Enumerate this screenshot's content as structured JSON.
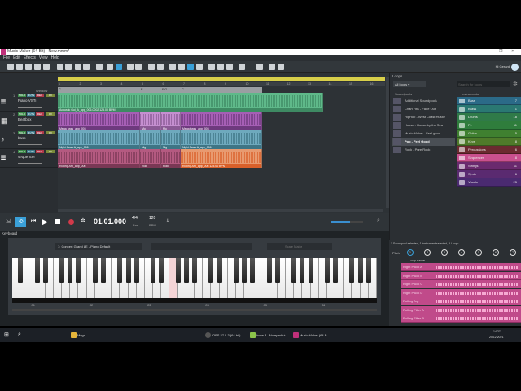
{
  "window": {
    "title": "Music Maker (64-Bit) - New.mmm*",
    "minimize": "–",
    "maximize": "❐",
    "close": "✕"
  },
  "menu": [
    "File",
    "Edit",
    "Effects",
    "View",
    "Help"
  ],
  "toolbar": {
    "user": "Hi Gerard"
  },
  "arranger": {
    "window_label": "Window",
    "chords": [
      "C",
      "F",
      "F,G",
      "C"
    ],
    "ruler": [
      "1",
      "2",
      "3",
      "4",
      "5",
      "6",
      "7",
      "8",
      "9",
      "10",
      "11",
      "12",
      "13",
      "14",
      "15",
      "16",
      "17"
    ]
  },
  "tracks": [
    {
      "num": "1",
      "name": "Piano VSTi",
      "icon": "piano-icon",
      "solo": "SOLO",
      "mute": "MUTE",
      "rec": "REC",
      "fx": "FX",
      "clips": [
        "Acoustic Gui_A_app_006.0002  125.00 BPM"
      ]
    },
    {
      "num": "2",
      "name": "Beatbox",
      "icon": "drum-machine-icon",
      "solo": "SOLO",
      "mute": "MUTE",
      "rec": "REC",
      "fx": "FX",
      "clips": [
        "Mega bass_app_006",
        "Mo",
        "Mo",
        "Mega bass_app_006"
      ]
    },
    {
      "num": "3",
      "name": "bass",
      "icon": "guitar-icon",
      "solo": "SOLO",
      "mute": "MUTE",
      "rec": "REC",
      "fx": "FX",
      "clips": [
        "Night Bass A_app_006",
        "Nig",
        "Nig",
        "Night Bass A_app_006"
      ]
    },
    {
      "num": "4",
      "name": "sequencer",
      "icon": "keyboard-icon",
      "solo": "SOLO",
      "mute": "MUTE",
      "rec": "REC",
      "fx": "FX",
      "clips": [
        "Rolling Arp_app_006",
        "Rolli",
        "Rolli",
        "Rolling Arp_app_006  125.00 BPM"
      ]
    }
  ],
  "transport": {
    "position": "01.01.000",
    "signature": "4/4",
    "signature_label": "Bar",
    "tempo": "120",
    "tempo_label": "BPM"
  },
  "keyboard": {
    "panel_title": "Keyboard",
    "preset": "1: Concert Grand LE - Piano Default",
    "scale": "Scale Major",
    "octave_labels": [
      "C1",
      "C2",
      "C3",
      "C4",
      "C5",
      "C6"
    ]
  },
  "loops": {
    "panel_title": "Loops",
    "filter": "All loops",
    "search_placeholder": "Search for loops",
    "soundpools_header": "Soundpools",
    "instruments_header": "Instruments",
    "soundpools": [
      "Additional Soundpools",
      "Chart Hits - Fade Out",
      "HipHop - West Coast Hustle",
      "House - House by the Sea",
      "Music Maker - Feel good",
      "Pop - Feel Good",
      "Rock - Pure Rock"
    ],
    "selected_soundpool": 5,
    "instruments": [
      {
        "name": "Bass",
        "count": "7",
        "color": "#2b6a88"
      },
      {
        "name": "Brass",
        "count": "1",
        "color": "#2a7872"
      },
      {
        "name": "Drums",
        "count": "18",
        "color": "#2f7a48"
      },
      {
        "name": "Fx",
        "count": "11",
        "color": "#2f7d3c"
      },
      {
        "name": "Guitar",
        "count": "5",
        "color": "#3f8030"
      },
      {
        "name": "Keys",
        "count": "8",
        "color": "#4f7a2a"
      },
      {
        "name": "Percussions",
        "count": "6",
        "color": "#6b2a30"
      },
      {
        "name": "Sequences",
        "count": "8",
        "color": "#c9508e"
      },
      {
        "name": "Strings",
        "count": "11",
        "color": "#6a2a6e"
      },
      {
        "name": "Synth",
        "count": "6",
        "color": "#5a2a70"
      },
      {
        "name": "Vocals",
        "count": "25",
        "color": "#4a2a70"
      }
    ],
    "selected_instrument": 7,
    "status": "1 Soundpool selected, 1 Instrument selected, 8 Loops.",
    "pitch_label": "Pitch",
    "pitch_values": [
      "1",
      "2",
      "3",
      "4",
      "5",
      "6",
      "7"
    ],
    "column_header": "Loop name",
    "loop_names": [
      "Night Pluck A",
      "Night Pluck B",
      "Night Pluck C",
      "Night Pluck D",
      "Rolling Arp",
      "Rolling Filter A",
      "Rolling Filter B"
    ]
  },
  "taskbar": {
    "items": [
      "Mega",
      "OBS 27.1.3 (64-bit)...",
      "*new 8 - Notepad++",
      "Music Maker (64-B..."
    ],
    "time": "14:27",
    "date": "20.12.2021"
  }
}
